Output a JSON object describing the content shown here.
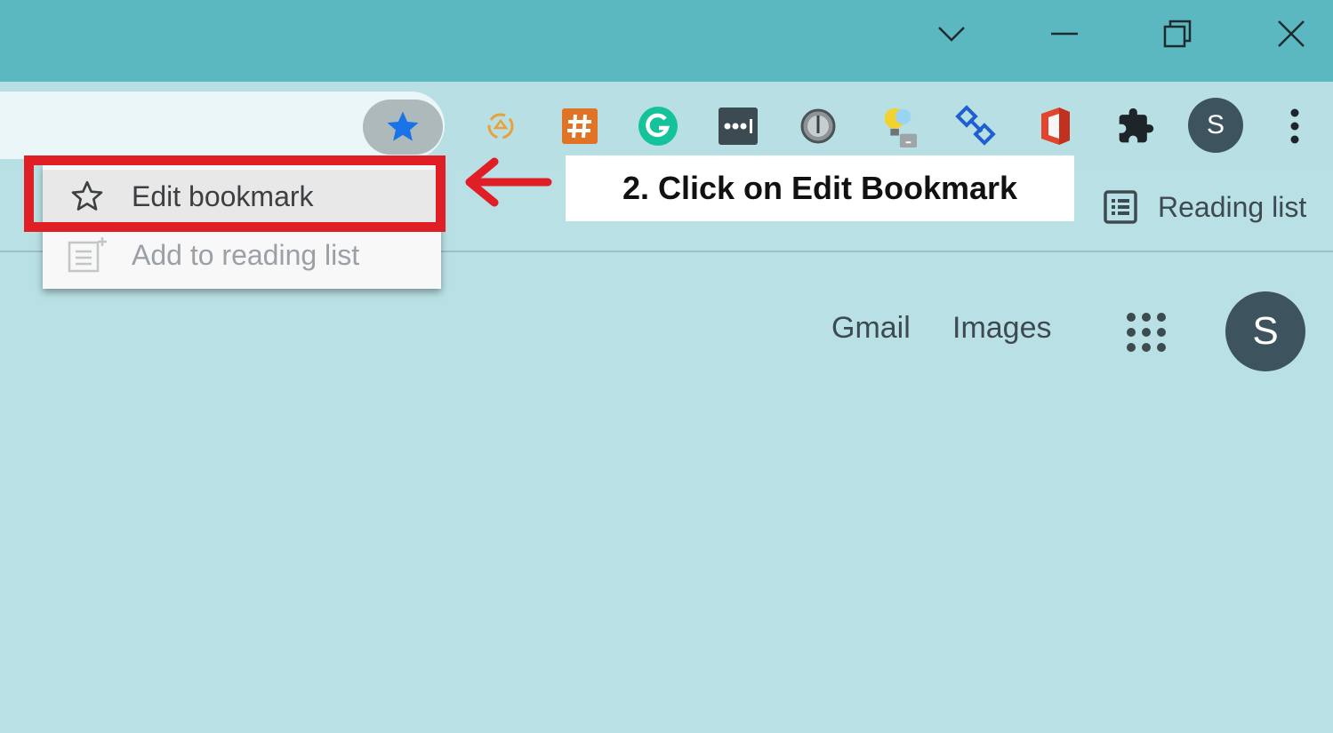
{
  "window": {
    "controls": [
      "tab-search",
      "minimize",
      "restore",
      "close"
    ]
  },
  "toolbar": {
    "profile_initial": "S",
    "extensions": [
      "circle-arrows-icon",
      "hashtag-icon",
      "grammarly-icon",
      "password-dots-icon",
      "compass-icon",
      "lightbulb-icon",
      "diamond-link-icon",
      "office-icon",
      "puzzle-icon"
    ]
  },
  "bookmark_menu": {
    "items": [
      {
        "label": "Edit bookmark",
        "icon": "star-outline-icon"
      },
      {
        "label": "Add to reading list",
        "icon": "reading-list-add-icon"
      }
    ]
  },
  "reading_list": {
    "label": "Reading list"
  },
  "annotation": {
    "text": "2. Click on Edit Bookmark",
    "highlight_color": "#e01e26"
  },
  "google": {
    "gmail": "Gmail",
    "images": "Images",
    "profile_initial": "S"
  },
  "colors": {
    "titlebar": "#5bb8c1",
    "page_bg": "#b9e1e5",
    "star_blue": "#1a73e8"
  }
}
